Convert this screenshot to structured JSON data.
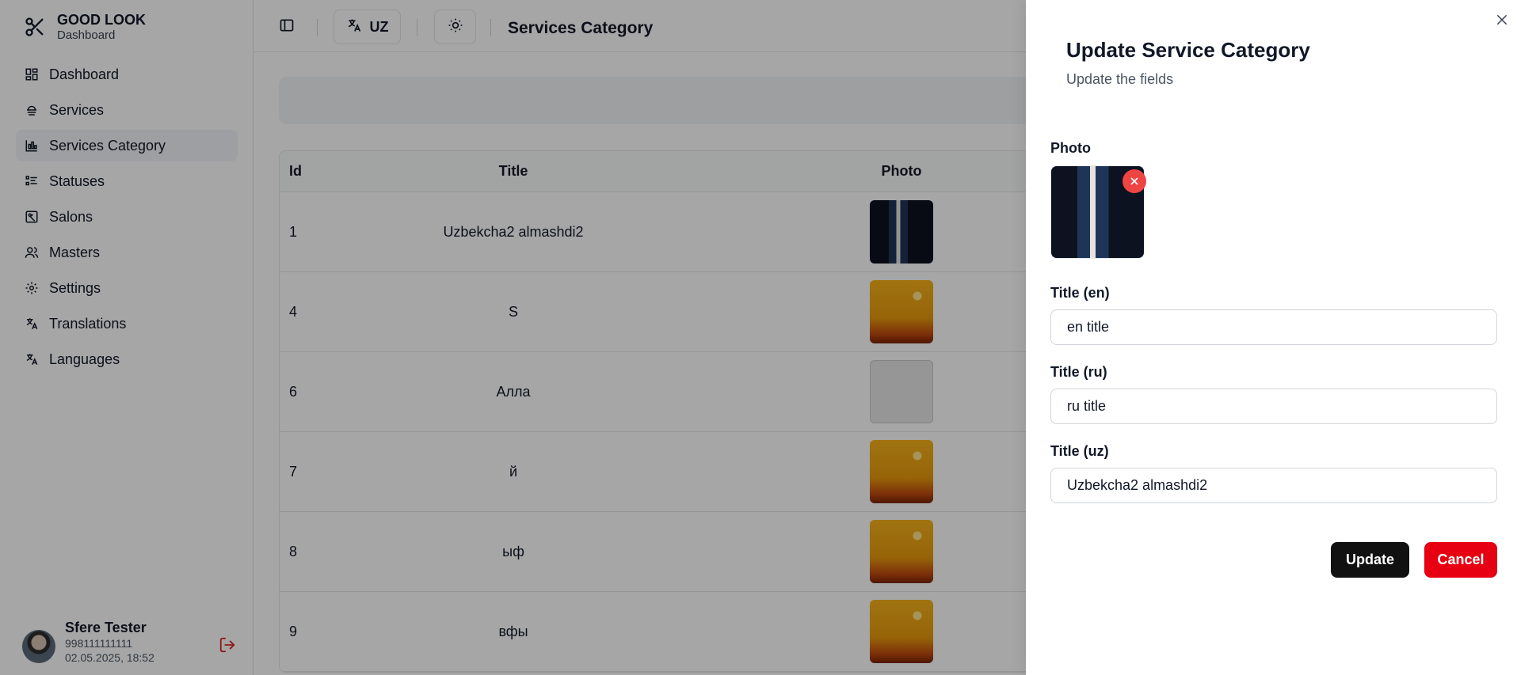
{
  "brand": {
    "title": "GOOD LOOK",
    "subtitle": "Dashboard"
  },
  "sidebar": {
    "items": [
      {
        "label": "Dashboard",
        "icon": "dashboard-icon"
      },
      {
        "label": "Services",
        "icon": "services-icon"
      },
      {
        "label": "Services Category",
        "icon": "chart-icon",
        "active": true
      },
      {
        "label": "Statuses",
        "icon": "list-icon"
      },
      {
        "label": "Salons",
        "icon": "salon-icon"
      },
      {
        "label": "Masters",
        "icon": "users-icon"
      },
      {
        "label": "Settings",
        "icon": "gear-icon"
      },
      {
        "label": "Translations",
        "icon": "translate-icon"
      },
      {
        "label": "Languages",
        "icon": "translate-icon"
      }
    ]
  },
  "user": {
    "name": "Sfere Tester",
    "phone": "998111111111",
    "date": "02.05.2025, 18:52"
  },
  "header": {
    "lang": "UZ",
    "title": "Services Category"
  },
  "table": {
    "columns": [
      "Id",
      "Title",
      "Photo"
    ],
    "rows": [
      {
        "id": "1",
        "title": "Uzbekcha2 almashdi2",
        "photo": "suit"
      },
      {
        "id": "4",
        "title": "S",
        "photo": "sunset"
      },
      {
        "id": "6",
        "title": "Алла",
        "photo": "comic"
      },
      {
        "id": "7",
        "title": "й",
        "photo": "sunset"
      },
      {
        "id": "8",
        "title": "ыф",
        "photo": "sunset"
      },
      {
        "id": "9",
        "title": "вфы",
        "photo": "sunset"
      }
    ]
  },
  "drawer": {
    "title": "Update Service Category",
    "subtitle": "Update the fields",
    "photo_label": "Photo",
    "fields": [
      {
        "label": "Title (en)",
        "value": "en title"
      },
      {
        "label": "Title (ru)",
        "value": "ru title"
      },
      {
        "label": "Title (uz)",
        "value": "Uzbekcha2 almashdi2"
      }
    ],
    "update_label": "Update",
    "cancel_label": "Cancel"
  },
  "colors": {
    "primary": "#111111",
    "danger": "#e60012",
    "remove": "#ef4444"
  }
}
